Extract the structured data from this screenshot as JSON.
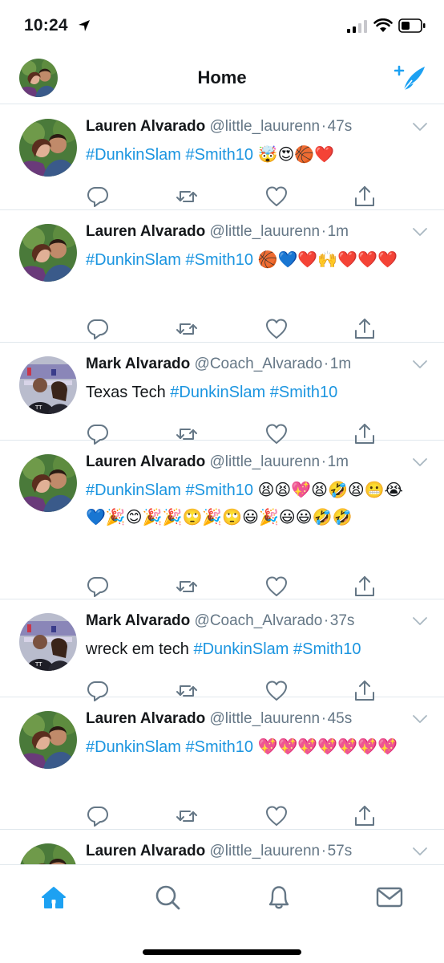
{
  "status_bar": {
    "time": "10:24"
  },
  "header": {
    "title": "Home"
  },
  "colors": {
    "accent": "#1da1f2",
    "hashtag": "#1b95e0",
    "secondary": "#657786",
    "divider": "#e1e8ed"
  },
  "tweets": [
    {
      "name": "Lauren Alvarado",
      "handle": "@little_lauurenn",
      "time": "47s",
      "avatar": "couple-photo",
      "parts": [
        [
          "tag",
          "#DunkinSlam"
        ],
        [
          "t",
          " "
        ],
        [
          "tag",
          "#Smith10"
        ],
        [
          "t",
          " 🤯😍🏀❤️"
        ]
      ]
    },
    {
      "name": "Lauren Alvarado",
      "handle": "@little_lauurenn",
      "time": "1m",
      "avatar": "couple-photo",
      "parts": [
        [
          "tag",
          "#DunkinSlam"
        ],
        [
          "t",
          " "
        ],
        [
          "tag",
          "#Smith10"
        ],
        [
          "t",
          " 🏀💙❤️🙌❤️❤️❤️"
        ]
      ]
    },
    {
      "name": "Mark Alvarado",
      "handle": "@Coach_Alvarado",
      "time": "1m",
      "avatar": "arena-photo",
      "parts": [
        [
          "t",
          "Texas Tech "
        ],
        [
          "tag",
          "#DunkinSlam"
        ],
        [
          "t",
          " "
        ],
        [
          "tag",
          "#Smith10"
        ]
      ]
    },
    {
      "name": "Lauren Alvarado",
      "handle": "@little_lauurenn",
      "time": "1m",
      "avatar": "couple-photo",
      "parts": [
        [
          "tag",
          "#DunkinSlam"
        ],
        [
          "t",
          " "
        ],
        [
          "tag",
          "#Smith10"
        ],
        [
          "t",
          " 😫😫💖😫🤣😫😬😭💙🎉😊🎉🎉🙄🎉🙄😃🎉😃😃🤣🤣"
        ]
      ]
    },
    {
      "name": "Mark Alvarado",
      "handle": "@Coach_Alvarado",
      "time": "37s",
      "avatar": "arena-photo",
      "parts": [
        [
          "t",
          "wreck em tech "
        ],
        [
          "tag",
          "#DunkinSlam"
        ],
        [
          "t",
          " "
        ],
        [
          "tag",
          "#Smith10"
        ]
      ]
    },
    {
      "name": "Lauren Alvarado",
      "handle": "@little_lauurenn",
      "time": "45s",
      "avatar": "couple-photo",
      "parts": [
        [
          "tag",
          "#DunkinSlam"
        ],
        [
          "t",
          " "
        ],
        [
          "tag",
          "#Smith10"
        ],
        [
          "t",
          " 💖💖💖💖💖💖💖"
        ]
      ]
    },
    {
      "name": "Lauren Alvarado",
      "handle": "@little_lauurenn",
      "time": "57s",
      "avatar": "couple-photo",
      "parts": []
    }
  ],
  "action_icons": [
    "reply-icon",
    "retweet-icon",
    "like-icon",
    "share-icon"
  ],
  "tab_bar": [
    {
      "name": "home",
      "icon": "home-icon",
      "active": true
    },
    {
      "name": "search",
      "icon": "search-icon",
      "active": false
    },
    {
      "name": "notifications",
      "icon": "bell-icon",
      "active": false
    },
    {
      "name": "messages",
      "icon": "mail-icon",
      "active": false
    }
  ]
}
